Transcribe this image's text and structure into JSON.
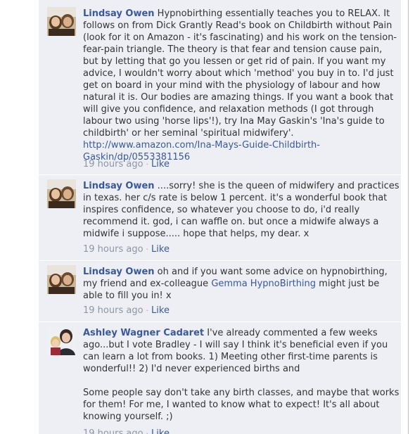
{
  "comments": [
    {
      "author": "Lindsay Owen",
      "text": " Hypnobirthing essentially teaches you to RELAX. It follows on from Dick Grantly Read's book on Childbirth without Pain (look for it on Amazon - it's fascinating) and his work on the tension-fear-pain triangle. The theory is that fear and tension cause pain, but by letting that go you lessen or get rid of pain. If you want my advice, I wouldn't worry about which 'method' you buy in to. I'd just get on board in your mind with the physiology of labour and how natural it is. Our bodies are amazing things. If you want a book that will give you confidence, and relaxation methods (I got through labour two using 'horse lips'!), try Ina May Gaskin's 'Ina's guide to childbirth' or her seminal 'spiritual midwifery'. ",
      "link": "http://www.amazon.com/Ina-Mays-Guide-Childbirth-Gaskin/dp/0553381156",
      "time": "19 hours ago",
      "like": "Like"
    },
    {
      "author": "Lindsay Owen",
      "text": " ....sorry! she is the queen of midwifery and practices in texas. her c/s rate is below 1 percent. it's a wonderful book that inspires confidence, so whatever you choose to do, i'd really recommend it. god, i can waffle on. but once a midwife always a midwife i suppose..... hope that helps, my dear. x",
      "time": "19 hours ago",
      "like": "Like"
    },
    {
      "author": "Lindsay Owen",
      "text_before": " oh and if you want some advice on hypnobirthing, my friend and ex-colleague ",
      "link": "Gemma HypnoBirthing",
      "text_after": " might just be able to fill you in! x",
      "time": "19 hours ago",
      "like": "Like"
    },
    {
      "author": "Ashley Wagner Cadaret",
      "text": " I've already commented a few weeks ago...but I vote Bradley - I will say I think it's beneficial even if you can learn a lot from books. 1) Meeting other first-time parents is wonderful!! 2) I'd never experienced births and\n\nSome people say don't take any birth classes, and maybe that works for them! For me, I wanted to know what to expect! It's all about knowing yourself. ;)",
      "time": "19 hours ago",
      "like": "Like"
    }
  ],
  "separator": "·",
  "colors": {
    "panel": "#edeff4",
    "author": "#3b5998",
    "meta": "#8d96a6"
  }
}
